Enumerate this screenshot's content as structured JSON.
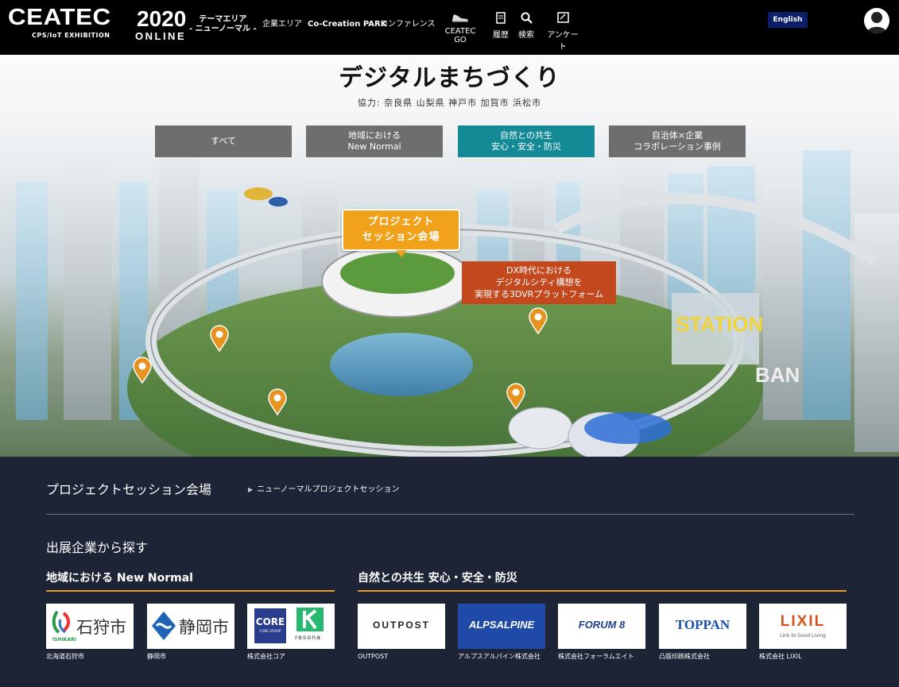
{
  "header": {
    "logo": {
      "brand": "CEATEC",
      "year": "2020",
      "subtitle": "CPS/IoT EXHIBITION",
      "online": "ONLINE"
    },
    "nav": {
      "theme_line1": "テーマエリア",
      "theme_line2": "- ニューノーマル -",
      "company_area": "企業エリア",
      "cocreation": "Co-Creation PARK",
      "conference": "コンファレンス",
      "ceatec_go": "CEATEC GO",
      "history": "履歴",
      "search": "検索",
      "survey": "アンケート"
    },
    "language_button": "English"
  },
  "hero": {
    "title": "デジタルまちづくり",
    "cooperation": "協力: 奈良県 山梨県 神戸市 加賀市 浜松市",
    "tabs": [
      {
        "line1": "すべて",
        "line2": ""
      },
      {
        "line1": "地域における",
        "line2": "New Normal"
      },
      {
        "line1": "自然との共生",
        "line2": "安心・安全・防災"
      },
      {
        "line1": "自治体×企業",
        "line2": "コラボレーション事例"
      }
    ],
    "active_tab": 2,
    "venue_callout": {
      "line1": "プロジェクト",
      "line2": "セッション会場"
    },
    "dx_callout": {
      "line1": "DX時代における",
      "line2": "デジタルシティ構想を",
      "line3": "実現する3DVRプラットフォーム"
    },
    "signage": {
      "station": "STATION",
      "bank": "BAN"
    }
  },
  "lower": {
    "session_title": "プロジェクトセッション会場",
    "session_link": "ニューノーマルプロジェクトセッション",
    "search_title": "出展企業から探す",
    "categories": [
      {
        "title": "地域における New Normal",
        "exhibitors": [
          {
            "logo_text": "石狩市",
            "logo_subtext": "ISHIKARI",
            "name": "北海道石狩市"
          },
          {
            "logo_text": "静岡市",
            "name": "静岡市"
          },
          {
            "logo_text": "CORE",
            "logo_subtext": "CORE GROUP",
            "logo_text2": "resona",
            "name": "株式会社コア"
          }
        ]
      },
      {
        "title": "自然との共生 安心・安全・防災",
        "exhibitors": [
          {
            "logo_text": "OUTPOST",
            "name": "OUTPOST"
          },
          {
            "logo_text": "ALPSALPINE",
            "name": "アルプスアルパイン株式会社"
          },
          {
            "logo_text": "FORUM 8",
            "name": "株式会社フォーラムエイト"
          },
          {
            "logo_text": "TOPPAN",
            "name": "凸版印刷株式会社"
          },
          {
            "logo_text": "LIXIL",
            "logo_subtext": "Link to Good Living",
            "name": "株式会社 LIXIL"
          }
        ]
      }
    ]
  },
  "colors": {
    "header_bg": "#000000",
    "language_button": "#0d1f6b",
    "tab_default": "#6e6e6e",
    "tab_active": "#138a96",
    "venue_callout": "#f2a11b",
    "dx_callout": "#c4481e",
    "lower_bg": "#1c2436",
    "accent_line": "#e89b25"
  },
  "icons": [
    "sneaker-icon",
    "history-book-icon",
    "search-icon",
    "survey-icon",
    "user-avatar-icon",
    "map-pin-icon",
    "chevron-right-icon"
  ]
}
